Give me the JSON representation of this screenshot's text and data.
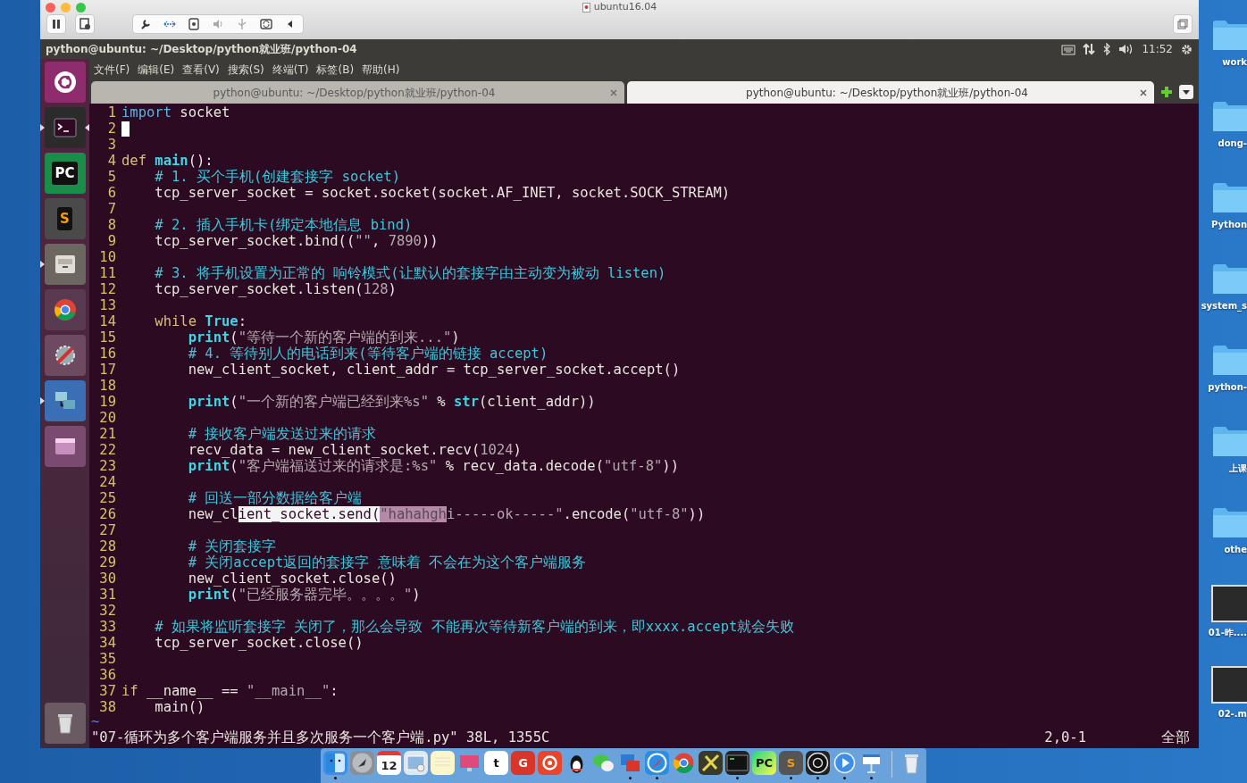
{
  "host_window": {
    "title": "ubuntu16.04"
  },
  "panel": {
    "title": "python@ubuntu: ~/Desktop/python就业班/python-04",
    "clock": "11:52"
  },
  "launcher": [
    {
      "kind": "ubuntu",
      "running": false,
      "focused": false
    },
    {
      "kind": "terminal",
      "running": true,
      "focused": true
    },
    {
      "kind": "ide",
      "glyph": "PC",
      "running": false,
      "focused": false
    },
    {
      "kind": "editor",
      "glyph": "S",
      "running": false,
      "focused": false
    },
    {
      "kind": "files",
      "running": true,
      "focused": false
    },
    {
      "kind": "browser",
      "running": false,
      "focused": false
    },
    {
      "kind": "settings",
      "running": false,
      "focused": false
    },
    {
      "kind": "network",
      "running": true,
      "focused": false
    },
    {
      "kind": "workspaces",
      "running": false,
      "focused": false
    },
    {
      "kind": "trash",
      "running": false,
      "focused": false
    }
  ],
  "menu": [
    "文件(F)",
    "编辑(E)",
    "查看(V)",
    "搜索(S)",
    "终端(T)",
    "标签(B)",
    "帮助(H)"
  ],
  "tabs": [
    {
      "label": "python@ubuntu: ~/Desktop/python就业班/python-04",
      "selected": false
    },
    {
      "label": "python@ubuntu: ~/Desktop/python就业班/python-04",
      "selected": true
    }
  ],
  "editor": {
    "lines": [
      {
        "number": "1",
        "cursor": false,
        "segments": [
          {
            "text": "import",
            "kind": "include"
          },
          {
            "text": " socket",
            "kind": "plain"
          }
        ]
      },
      {
        "number": "2",
        "cursor": true
      },
      {
        "number": "3",
        "cursor": false
      },
      {
        "number": "4",
        "cursor": false,
        "segments": [
          {
            "text": "def ",
            "kind": "keyword"
          },
          {
            "text": "main",
            "kind": "builtin"
          },
          {
            "text": "():",
            "kind": "plain"
          }
        ]
      },
      {
        "number": "5",
        "cursor": false,
        "segments": [
          {
            "text": "    # 1. 买个手机(创建套接字 socket)",
            "kind": "comment"
          }
        ]
      },
      {
        "number": "6",
        "cursor": false,
        "segments": [
          {
            "text": "    tcp_server_socket = socket.socket(socket.AF_INET, socket.SOCK_STREAM)",
            "kind": "plain"
          }
        ]
      },
      {
        "number": "7",
        "cursor": false
      },
      {
        "number": "8",
        "cursor": false,
        "segments": [
          {
            "text": "    # 2. 插入手机卡(绑定本地信息 bind)",
            "kind": "comment"
          }
        ]
      },
      {
        "number": "9",
        "cursor": false,
        "segments": [
          {
            "text": "    tcp_server_socket.bind((",
            "kind": "plain"
          },
          {
            "text": "\"\"",
            "kind": "string"
          },
          {
            "text": ", ",
            "kind": "plain"
          },
          {
            "text": "7890",
            "kind": "number"
          },
          {
            "text": "))",
            "kind": "plain"
          }
        ]
      },
      {
        "number": "10",
        "cursor": false
      },
      {
        "number": "11",
        "cursor": false,
        "segments": [
          {
            "text": "    # 3. 将手机设置为正常的 响铃模式(让默认的套接字由主动变为被动 listen)",
            "kind": "comment"
          }
        ]
      },
      {
        "number": "12",
        "cursor": false,
        "segments": [
          {
            "text": "    tcp_server_socket.listen(",
            "kind": "plain"
          },
          {
            "text": "128",
            "kind": "number"
          },
          {
            "text": ")",
            "kind": "plain"
          }
        ]
      },
      {
        "number": "13",
        "cursor": false
      },
      {
        "number": "14",
        "cursor": false,
        "segments": [
          {
            "text": "    while ",
            "kind": "keyword"
          },
          {
            "text": "True",
            "kind": "builtin"
          },
          {
            "text": ":",
            "kind": "plain"
          }
        ]
      },
      {
        "number": "15",
        "cursor": false,
        "segments": [
          {
            "text": "        print",
            "kind": "builtin"
          },
          {
            "text": "(",
            "kind": "plain"
          },
          {
            "text": "\"等待一个新的客户端的到来...\"",
            "kind": "string"
          },
          {
            "text": ")",
            "kind": "plain"
          }
        ]
      },
      {
        "number": "16",
        "cursor": false,
        "segments": [
          {
            "text": "        # 4. 等待别人的电话到来(等待客户端的链接 accept)",
            "kind": "comment"
          }
        ]
      },
      {
        "number": "17",
        "cursor": false,
        "segments": [
          {
            "text": "        new_client_socket, client_addr = tcp_server_socket.accept()",
            "kind": "plain"
          }
        ]
      },
      {
        "number": "18",
        "cursor": false
      },
      {
        "number": "19",
        "cursor": false,
        "segments": [
          {
            "text": "        print",
            "kind": "builtin"
          },
          {
            "text": "(",
            "kind": "plain"
          },
          {
            "text": "\"一个新的客户端已经到来%s\"",
            "kind": "string"
          },
          {
            "text": " % ",
            "kind": "plain"
          },
          {
            "text": "str",
            "kind": "builtin"
          },
          {
            "text": "(client_addr))",
            "kind": "plain"
          }
        ]
      },
      {
        "number": "20",
        "cursor": false
      },
      {
        "number": "21",
        "cursor": false,
        "segments": [
          {
            "text": "        # 接收客户端发送过来的请求",
            "kind": "comment"
          }
        ]
      },
      {
        "number": "22",
        "cursor": false,
        "segments": [
          {
            "text": "        recv_data = new_client_socket.recv(",
            "kind": "plain"
          },
          {
            "text": "1024",
            "kind": "number"
          },
          {
            "text": ")",
            "kind": "plain"
          }
        ]
      },
      {
        "number": "23",
        "cursor": false,
        "segments": [
          {
            "text": "        print",
            "kind": "builtin"
          },
          {
            "text": "(",
            "kind": "plain"
          },
          {
            "text": "\"客户端福送过来的请求是:%s\"",
            "kind": "string"
          },
          {
            "text": " % recv_data.decode(",
            "kind": "plain"
          },
          {
            "text": "\"utf-8\"",
            "kind": "string"
          },
          {
            "text": "))",
            "kind": "plain"
          }
        ]
      },
      {
        "number": "24",
        "cursor": false
      },
      {
        "number": "25",
        "cursor": false,
        "segments": [
          {
            "text": "        # 回送一部分数据给客户端",
            "kind": "comment"
          }
        ]
      },
      {
        "number": "26",
        "cursor": false,
        "segments": [
          {
            "text": "        new_cl",
            "kind": "plain"
          },
          {
            "text": "ient_socket.send(",
            "kind": "selected"
          },
          {
            "text": "\"hahahgh",
            "kind": "selected_string"
          },
          {
            "text": "i-----ok-----\"",
            "kind": "string"
          },
          {
            "text": ".encode(",
            "kind": "plain"
          },
          {
            "text": "\"utf-8\"",
            "kind": "string"
          },
          {
            "text": "))",
            "kind": "plain"
          }
        ]
      },
      {
        "number": "27",
        "cursor": false
      },
      {
        "number": "28",
        "cursor": false,
        "segments": [
          {
            "text": "        # 关闭套接字",
            "kind": "comment"
          }
        ]
      },
      {
        "number": "29",
        "cursor": false,
        "segments": [
          {
            "text": "        # 关闭accept返回的套接字 意味着 不会在为这个客户端服务",
            "kind": "comment"
          }
        ]
      },
      {
        "number": "30",
        "cursor": false,
        "segments": [
          {
            "text": "        new_client_socket.close()",
            "kind": "plain"
          }
        ]
      },
      {
        "number": "31",
        "cursor": false,
        "segments": [
          {
            "text": "        print",
            "kind": "builtin"
          },
          {
            "text": "(",
            "kind": "plain"
          },
          {
            "text": "\"已经服务器完毕。。。。\"",
            "kind": "string"
          },
          {
            "text": ")",
            "kind": "plain"
          }
        ]
      },
      {
        "number": "32",
        "cursor": false
      },
      {
        "number": "33",
        "cursor": false,
        "segments": [
          {
            "text": "    # 如果将监听套接字 关闭了，那么会导致 不能再次等待新客户端的到来，即xxxx.accept就会失败",
            "kind": "comment"
          }
        ]
      },
      {
        "number": "34",
        "cursor": false,
        "segments": [
          {
            "text": "    tcp_server_socket.close()",
            "kind": "plain"
          }
        ]
      },
      {
        "number": "35",
        "cursor": false
      },
      {
        "number": "36",
        "cursor": false
      },
      {
        "number": "37",
        "cursor": false,
        "segments": [
          {
            "text": "if",
            "kind": "keyword"
          },
          {
            "text": " __name__ == ",
            "kind": "plain"
          },
          {
            "text": "\"__main__\"",
            "kind": "string"
          },
          {
            "text": ":",
            "kind": "plain"
          }
        ]
      },
      {
        "number": "38",
        "cursor": false,
        "segments": [
          {
            "text": "    main()",
            "kind": "plain"
          }
        ]
      }
    ],
    "filler": "~"
  },
  "status_line": {
    "file_info": "\"07-循环为多个客户端服务并且多次服务一个客户端.py\" 38L, 1355C",
    "position": "2,0-1",
    "scroll": "全部"
  },
  "desktop_items": [
    {
      "label": "work",
      "kind": "folder"
    },
    {
      "label": "dong-",
      "kind": "folder"
    },
    {
      "label": "Python",
      "kind": "folder"
    },
    {
      "label": "system_s",
      "kind": "folder"
    },
    {
      "label": "python-",
      "kind": "folder"
    },
    {
      "label": "上课",
      "kind": "folder"
    },
    {
      "label": "othe",
      "kind": "folder"
    },
    {
      "label": "01-昨....",
      "kind": "video"
    },
    {
      "label": "02-.m",
      "kind": "video"
    }
  ],
  "dock": [
    {
      "kind": "finder",
      "running": true
    },
    {
      "kind": "launchpad",
      "running": false
    },
    {
      "kind": "calendar",
      "glyph": "12",
      "running": false
    },
    {
      "kind": "preview",
      "running": false
    },
    {
      "kind": "notes",
      "running": false
    },
    {
      "kind": "monitor",
      "running": false
    },
    {
      "kind": "letter",
      "glyph": "t",
      "running": false
    },
    {
      "kind": "letter_red",
      "glyph": "G",
      "running": false
    },
    {
      "kind": "music",
      "running": false
    },
    {
      "kind": "penguin",
      "running": false
    },
    {
      "kind": "chat",
      "running": false
    },
    {
      "kind": "remote",
      "running": true
    },
    {
      "kind": "compass",
      "running": true
    },
    {
      "kind": "browser",
      "running": false
    },
    {
      "kind": "game",
      "running": false
    },
    {
      "kind": "terminal",
      "running": true
    },
    {
      "kind": "ide",
      "glyph": "PC",
      "running": false
    },
    {
      "kind": "editor",
      "glyph": "S",
      "running": true
    },
    {
      "kind": "recorder",
      "running": true
    },
    {
      "kind": "player",
      "running": true
    },
    {
      "kind": "presenter",
      "running": true
    },
    {
      "kind": "trash",
      "running": false
    }
  ]
}
